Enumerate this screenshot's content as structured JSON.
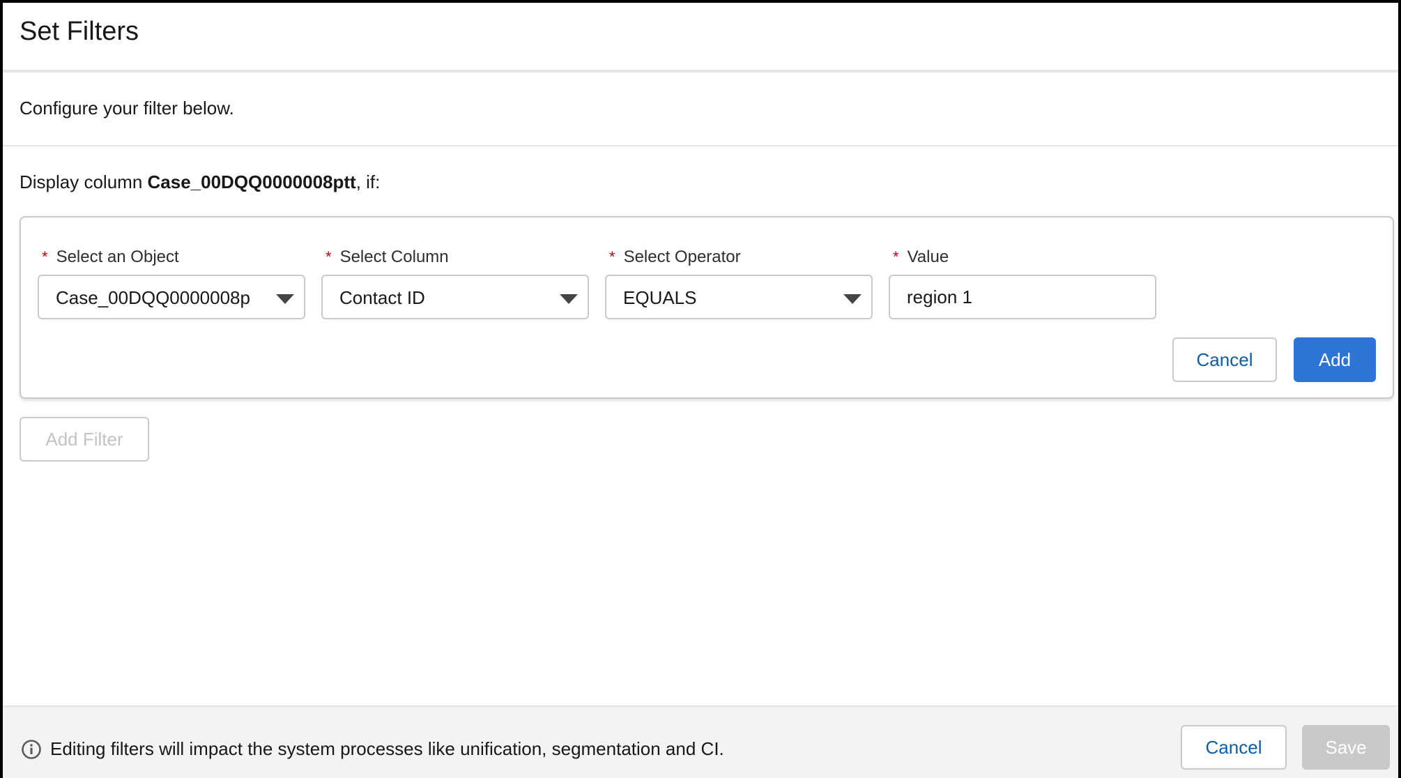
{
  "modal": {
    "title": "Set Filters",
    "intro": "Configure your filter below."
  },
  "display": {
    "prefix": "Display column ",
    "column": "Case_00DQQ0000008ptt",
    "suffix": ", if:"
  },
  "filter": {
    "required_mark": "*",
    "object": {
      "label": "Select an Object",
      "value": "Case_00DQQ0000008p"
    },
    "column": {
      "label": "Select Column",
      "value": "Contact ID"
    },
    "operator": {
      "label": "Select Operator",
      "value": "EQUALS"
    },
    "value": {
      "label": "Value",
      "value": "region 1"
    },
    "cancel_label": "Cancel",
    "add_label": "Add"
  },
  "add_filter_label": "Add Filter",
  "footer": {
    "note": "Editing filters will impact the system processes like unification, segmentation and CI.",
    "cancel_label": "Cancel",
    "save_label": "Save"
  },
  "colors": {
    "brand": "#2e74d4",
    "link": "#0b5cab",
    "required": "#ba0517",
    "border": "#c9c9c9",
    "footer_bg": "#f3f3f3"
  },
  "icons": {
    "footer_info": "info-icon",
    "dropdown": "chevron-down-icon"
  }
}
